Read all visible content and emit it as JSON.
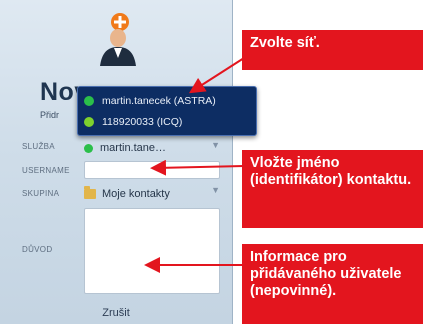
{
  "dialog": {
    "title": "Nov",
    "subtitle": "Přidr",
    "fields": {
      "service_label": "SLUŽBA",
      "service_value": "martin.tane…",
      "username_label": "USERNAME",
      "username_value": "",
      "group_label": "SKUPINA",
      "group_value": "Moje kontakty",
      "reason_label": "DŮVOD",
      "reason_value": ""
    },
    "cancel_label": "Zrušit"
  },
  "network_dropdown": {
    "items": [
      {
        "label": "martin.tanecek (ASTRA)",
        "status_color": "#2bbf4a"
      },
      {
        "label": "118920033 (ICQ)",
        "status_color": "#7fd12d"
      }
    ]
  },
  "callouts": {
    "network": "Zvolte síť.",
    "name": "Vložte jméno (identifikátor) kontaktu.",
    "info": "Informace pro přidávaného uživatele (nepovinné)."
  },
  "colors": {
    "callout_bg": "#e3151e",
    "popup_bg": "#0d2d63",
    "dialog_bg": "#d3dfea"
  }
}
